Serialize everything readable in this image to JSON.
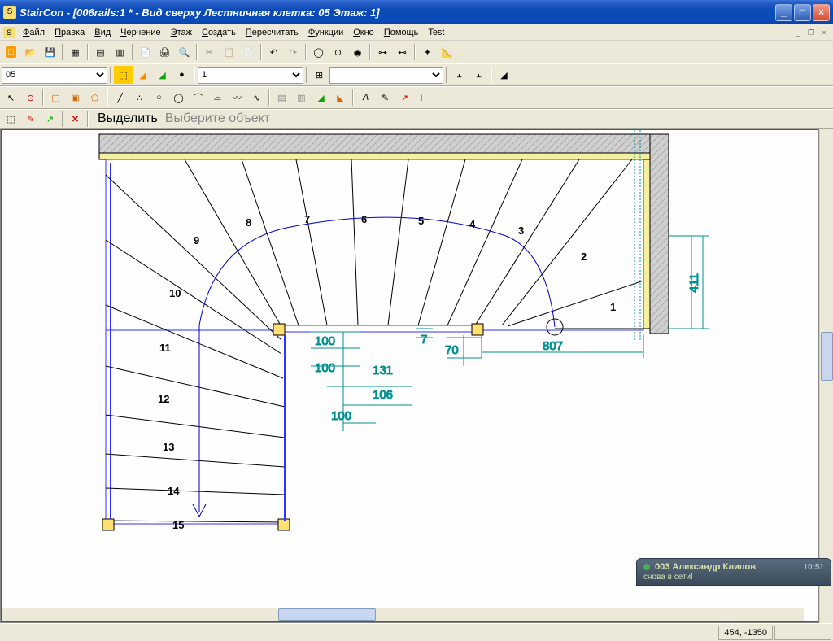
{
  "title": "StairCon - [006rails:1 * - Вид сверху Лестничная клетка: 05 Этаж: 1]",
  "menu": [
    "Файл",
    "Правка",
    "Вид",
    "Черчение",
    "Этаж",
    "Создать",
    "Пересчитать",
    "Функции",
    "Окно",
    "Помощь",
    "Test"
  ],
  "combo1": "05",
  "combo2": "1",
  "select_label": "Выделить",
  "select_hint": "Выберите объект",
  "status_coords": "454, -1350",
  "notif": {
    "title": "003 Александр Клипов",
    "time": "10:51",
    "body": "снова в сети!"
  },
  "stair": {
    "steps": [
      "1",
      "2",
      "3",
      "4",
      "5",
      "6",
      "7",
      "8",
      "9",
      "10",
      "11",
      "12",
      "13",
      "14",
      "15"
    ],
    "dims": {
      "d411": "411",
      "d807": "807",
      "d7": "7",
      "d70": "70",
      "d131": "131",
      "d106": "106",
      "d100a": "100",
      "d100b": "100",
      "d100c": "100"
    }
  }
}
